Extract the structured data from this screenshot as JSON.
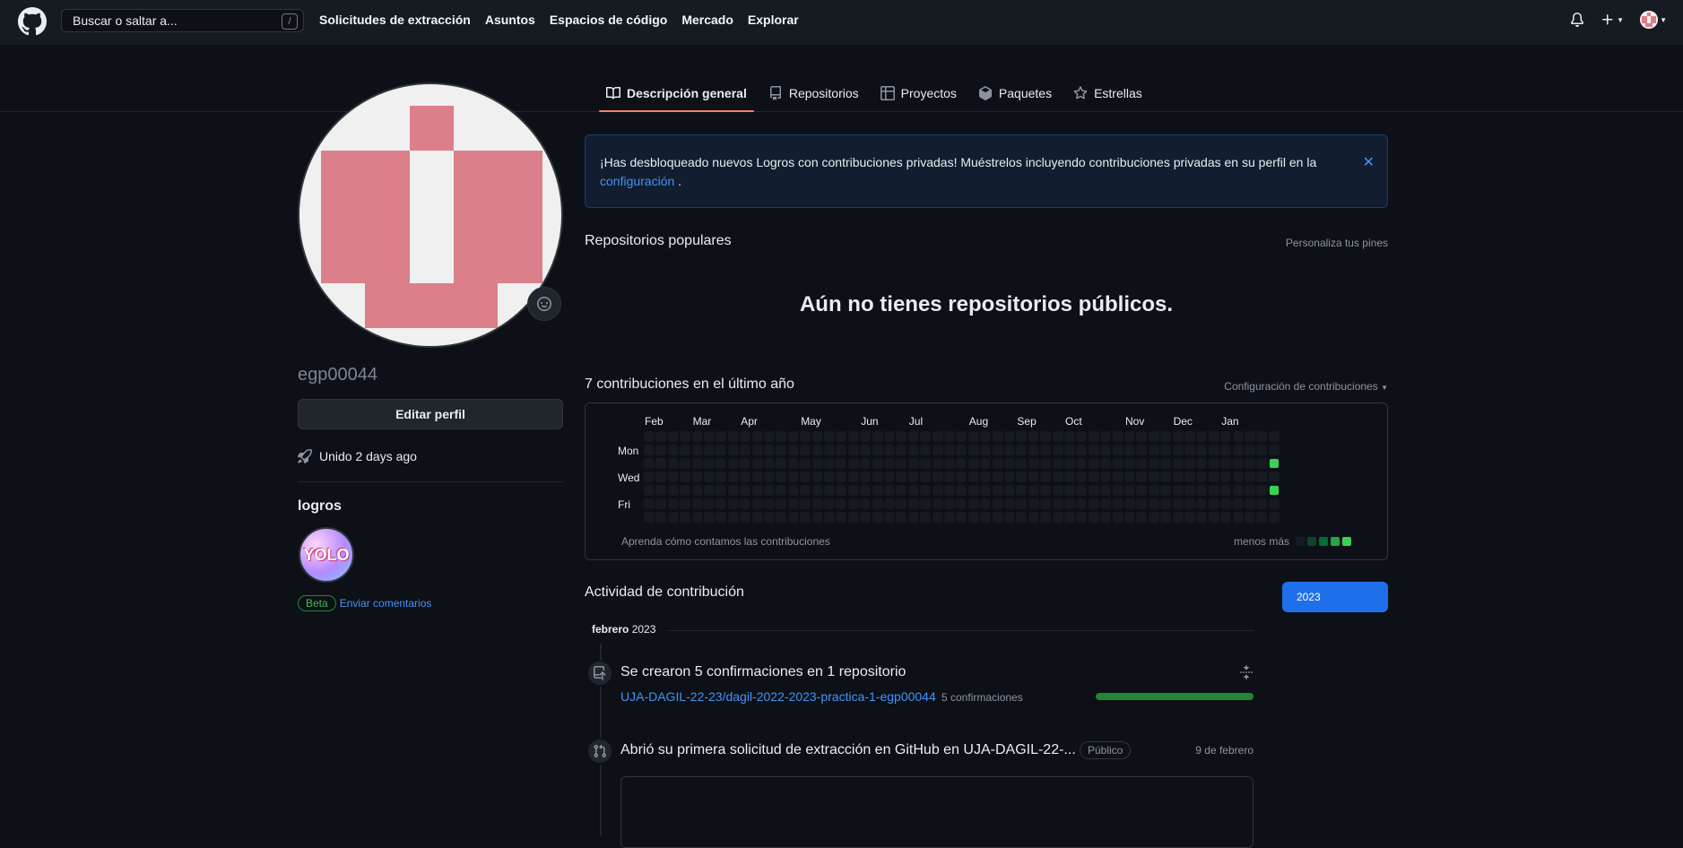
{
  "header": {
    "search_placeholder": "Buscar o saltar a...",
    "search_shortcut": "/",
    "nav": [
      "Solicitudes de extracción",
      "Asuntos",
      "Espacios de código",
      "Mercado",
      "Explorar"
    ]
  },
  "tabs": [
    "Descripción general",
    "Repositorios",
    "Proyectos",
    "Paquetes",
    "Estrellas"
  ],
  "profile": {
    "username": "egp00044",
    "edit_button": "Editar perfil",
    "joined": "Unido 2 days ago",
    "achievements_title": "logros",
    "achievement_badge_text": "YOLO",
    "beta_label": "Beta",
    "feedback_link": "Enviar comentarios"
  },
  "flash": {
    "text": "¡Has desbloqueado nuevos Logros con contribuciones privadas! Muéstrelos incluyendo contribuciones privadas en su perfil en la",
    "link": "configuración",
    "suffix": " .",
    "close": "✕"
  },
  "popular": {
    "title": "Repositorios populares",
    "customize": "Personaliza tus pines",
    "empty": "Aún no tienes repositorios públicos."
  },
  "contributions": {
    "title": "7 contribuciones en el último año",
    "settings": "Configuración de contribuciones",
    "months": [
      "Feb",
      "Mar",
      "Apr",
      "May",
      "Jun",
      "Jul",
      "Aug",
      "Sep",
      "Oct",
      "Nov",
      "Dec",
      "Jan"
    ],
    "days": [
      "Mon",
      "Wed",
      "Fri"
    ],
    "learn": "Aprenda cómo contamos las contribuciones",
    "legend_less_more": "menos más",
    "active_cells": [
      {
        "week": 52,
        "day": 2
      },
      {
        "week": 52,
        "day": 4
      }
    ],
    "colors": {
      "empty": "#161b22",
      "level4": "#39d353"
    }
  },
  "activity": {
    "title": "Actividad de contribución",
    "year_button": "2023",
    "month": "febrero",
    "year": "2023",
    "commits_title": "Se crearon 5 confirmaciones en 1 repositorio",
    "repo": "UJA-DAGIL-22-23/dagil-2022-2023-practica-1-egp00044",
    "commits_count": "5 confirmaciones",
    "commits_progress": 1.0,
    "pr_title": "Abrió su primera solicitud de extracción en GitHub en UJA-DAGIL-22-...",
    "pr_visibility": "Público",
    "pr_date": "9 de febrero"
  }
}
